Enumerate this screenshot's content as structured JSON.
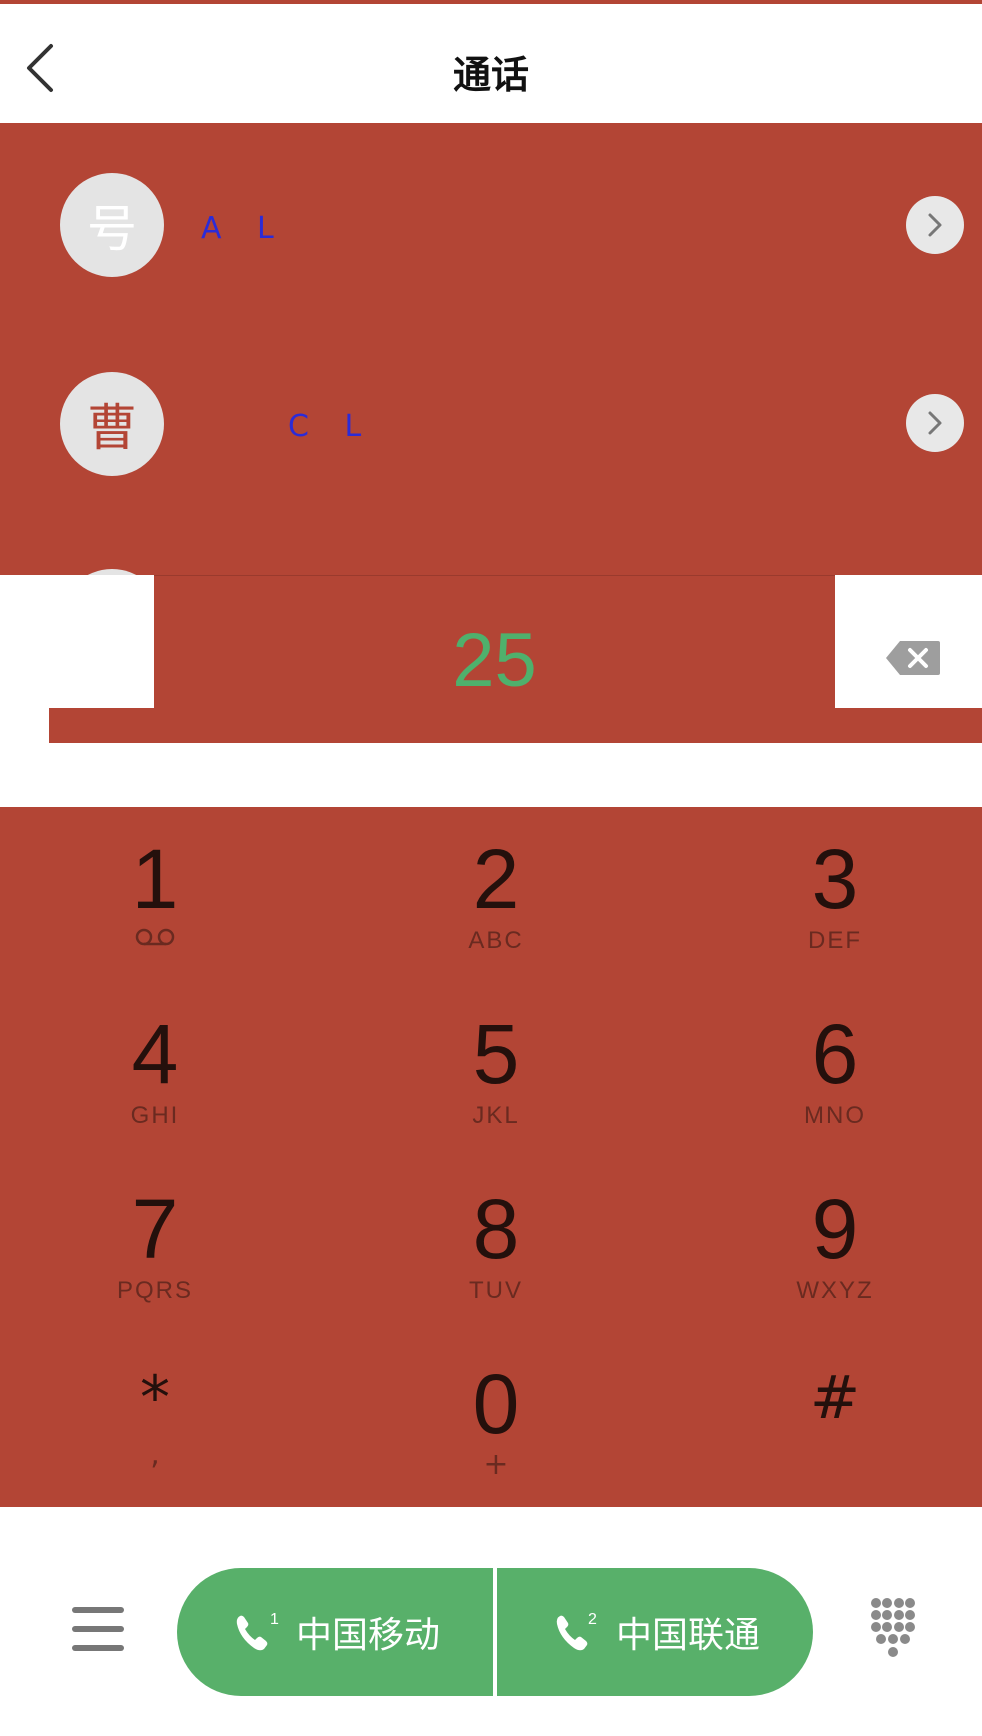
{
  "header": {
    "title": "通话"
  },
  "contacts": [
    {
      "avatar_char": "号",
      "name": "A L"
    },
    {
      "avatar_char": "曹",
      "name": "C L"
    }
  ],
  "dial_input": {
    "number": "25"
  },
  "keypad": [
    {
      "digit": "1",
      "letters": "voicemail-icon"
    },
    {
      "digit": "2",
      "letters": "ABC"
    },
    {
      "digit": "3",
      "letters": "DEF"
    },
    {
      "digit": "4",
      "letters": "GHI"
    },
    {
      "digit": "5",
      "letters": "JKL"
    },
    {
      "digit": "6",
      "letters": "MNO"
    },
    {
      "digit": "7",
      "letters": "PQRS"
    },
    {
      "digit": "8",
      "letters": "TUV"
    },
    {
      "digit": "9",
      "letters": "WXYZ"
    },
    {
      "digit": "*",
      "letters": ","
    },
    {
      "digit": "0",
      "letters": "+"
    },
    {
      "digit": "#",
      "letters": ""
    }
  ],
  "bottom_bar": {
    "sim1_label": "中国移动",
    "sim1_badge": "1",
    "sim2_label": "中国联通",
    "sim2_badge": "2"
  },
  "colors": {
    "overlay_red": "#b34535",
    "call_green": "#58b06a",
    "number_green": "#4fb06c",
    "name_blue": "#2b2bd8"
  },
  "icons": [
    "back-arrow-icon",
    "chevron-right-icon",
    "backspace-icon",
    "voicemail-icon",
    "menu-icon",
    "phone-icon",
    "dialpad-icon"
  ]
}
